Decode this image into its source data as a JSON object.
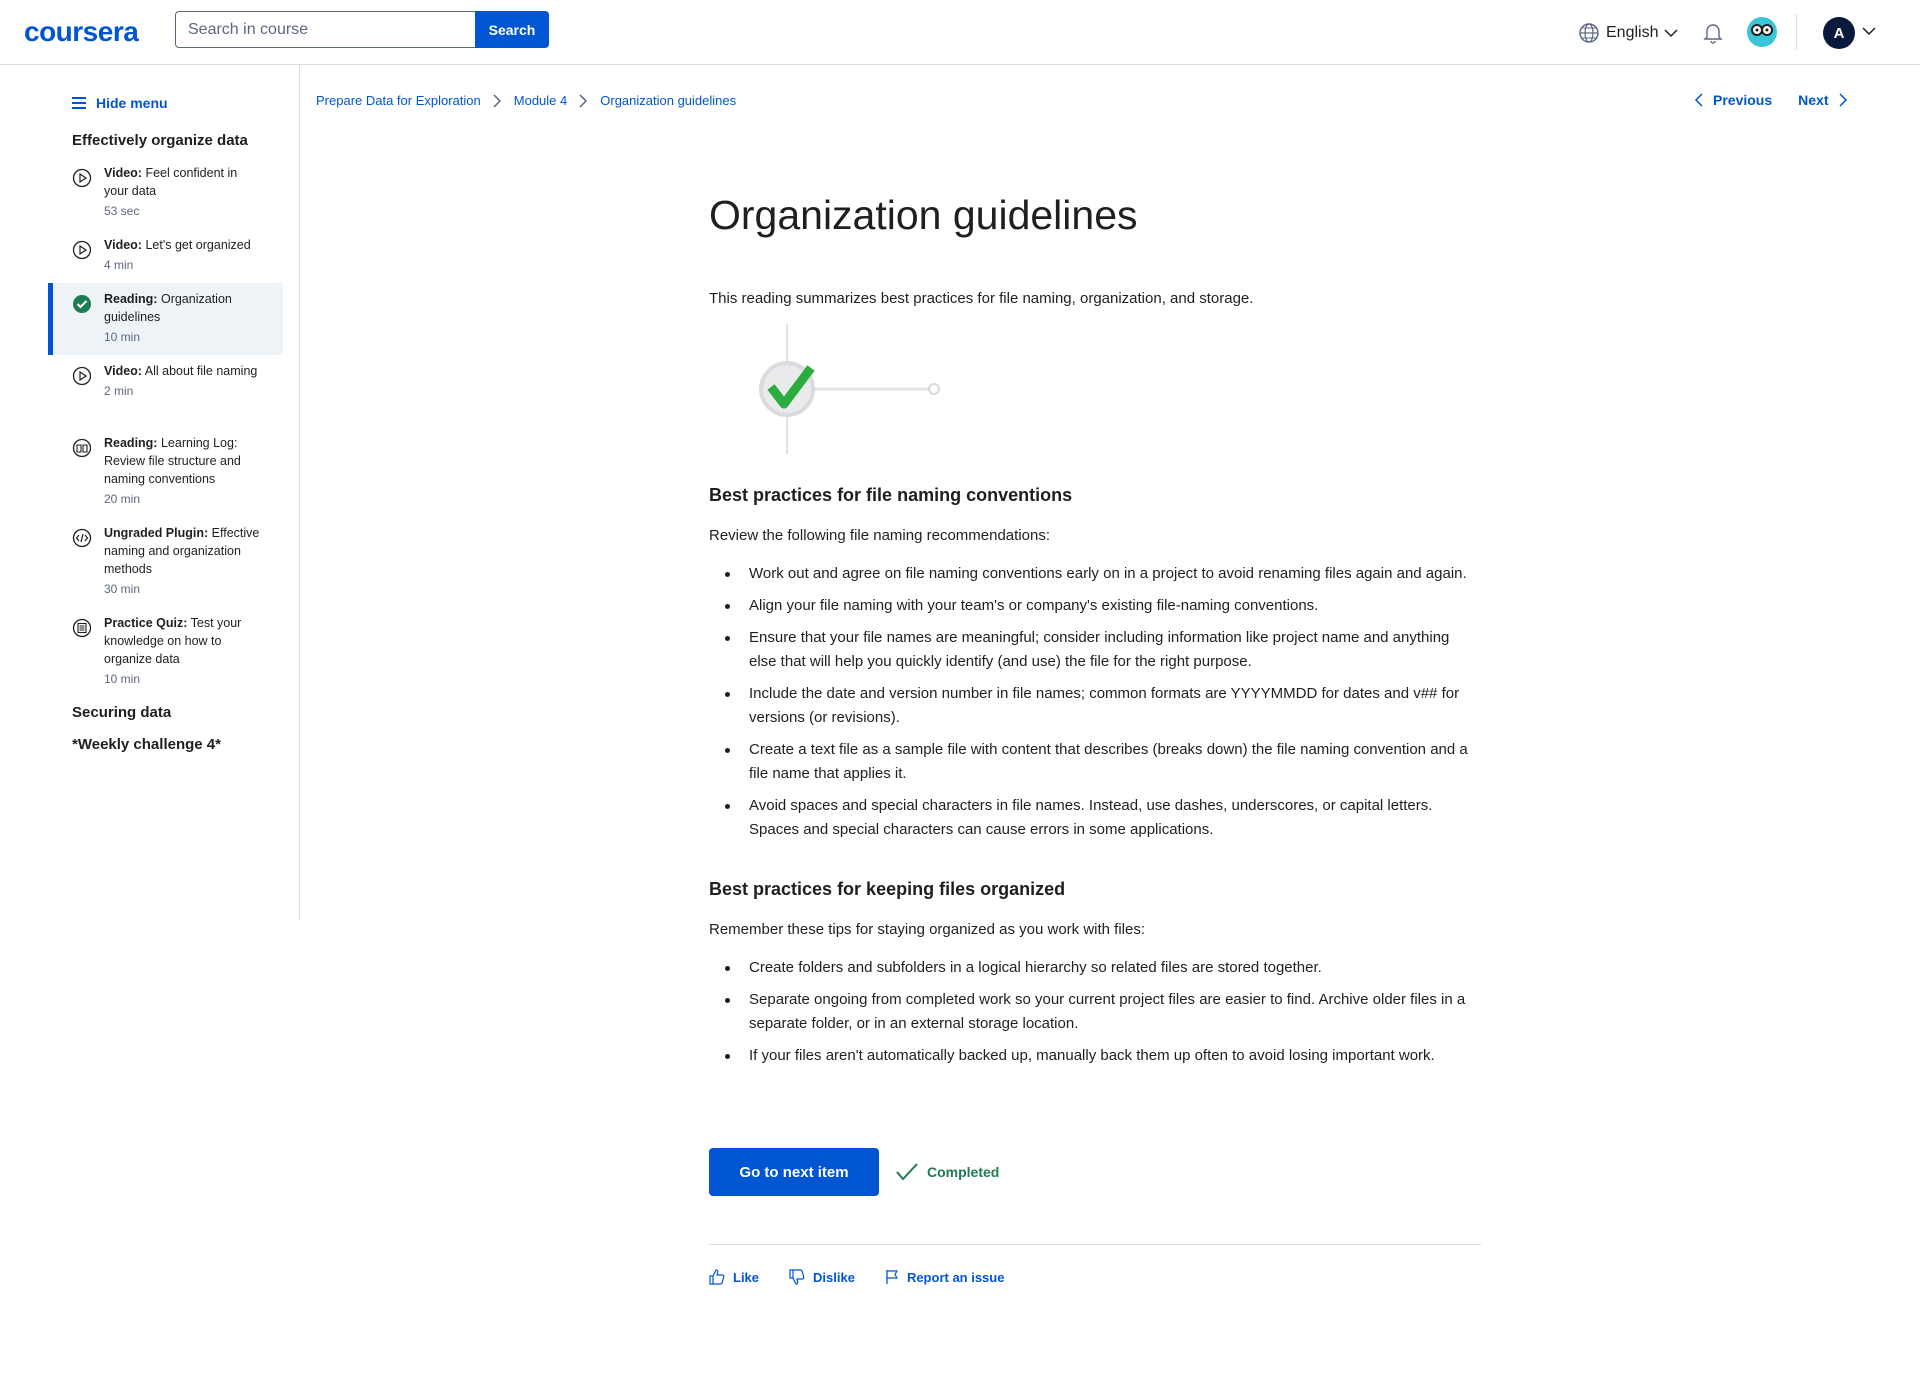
{
  "header": {
    "logo": "coursera",
    "search_placeholder": "Search in course",
    "search_button": "Search",
    "language": "English",
    "avatar_initial": "A"
  },
  "sidebar": {
    "hide_menu": "Hide menu",
    "section_title": "Effectively organize data",
    "items": [
      {
        "type": "Video:",
        "title": "Feel confident in your data",
        "time": "53 sec",
        "icon": "play-circle-icon"
      },
      {
        "type": "Video:",
        "title": "Let's get organized",
        "time": "4 min",
        "icon": "play-circle-icon"
      },
      {
        "type": "Reading:",
        "title": "Organization guidelines",
        "time": "10 min",
        "icon": "check-circle-icon"
      },
      {
        "type": "Video:",
        "title": "All about file naming",
        "time": "2 min",
        "icon": "play-circle-icon"
      },
      {
        "type": "Reading:",
        "title": "Learning Log: Review file structure and naming conventions",
        "time": "20 min",
        "icon": "book-icon"
      },
      {
        "type": "Ungraded Plugin:",
        "title": "Effective naming and organization methods",
        "time": "30 min",
        "icon": "code-icon"
      },
      {
        "type": "Practice Quiz:",
        "title": "Test your knowledge on how to organize data",
        "time": "10 min",
        "icon": "quiz-icon"
      }
    ],
    "other_sections": [
      "Securing data",
      "*Weekly challenge 4*"
    ]
  },
  "breadcrumb": [
    "Prepare Data for Exploration",
    "Module 4",
    "Organization guidelines"
  ],
  "nav": {
    "previous": "Previous",
    "next": "Next"
  },
  "content": {
    "title": "Organization guidelines",
    "intro": "This reading summarizes best practices for file naming, organization, and storage.",
    "section1": {
      "heading": "Best practices for file naming conventions",
      "lead": "Review the following file naming recommendations:",
      "bullets": [
        "Work out and agree on file naming conventions early on in a project to avoid renaming files again and again.",
        "Align your file naming with your team's or company's existing file-naming conventions.",
        "Ensure that your file names are meaningful; consider including information like project name and anything else that will help you quickly identify (and use) the file for the right purpose.",
        "Include the date and version number in file names; common formats are YYYYMMDD for dates and v## for versions (or revisions).",
        "Create a text file as a sample file with content that describes (breaks down) the file naming convention and a file name that applies it.",
        "Avoid spaces and special characters in file names. Instead, use dashes, underscores, or capital letters. Spaces and special characters can cause errors in some applications."
      ]
    },
    "section2": {
      "heading": "Best practices for keeping files organized",
      "lead": "Remember these tips for staying organized as you work with files:",
      "bullets": [
        "Create folders and subfolders in a logical hierarchy so related files are stored together.",
        "Separate ongoing from completed work so your current project files are easier to find. Archive older files in a separate folder, or in an external storage location.",
        "If your files aren't automatically backed up, manually back them up often to avoid losing important work."
      ]
    }
  },
  "actions": {
    "next_item": "Go to next item",
    "completed": "Completed"
  },
  "feedback": {
    "like": "Like",
    "dislike": "Dislike",
    "report": "Report an issue"
  },
  "colors": {
    "brand": "#0056d2",
    "success": "#1d7c50",
    "active_bg": "#eef3f8"
  }
}
